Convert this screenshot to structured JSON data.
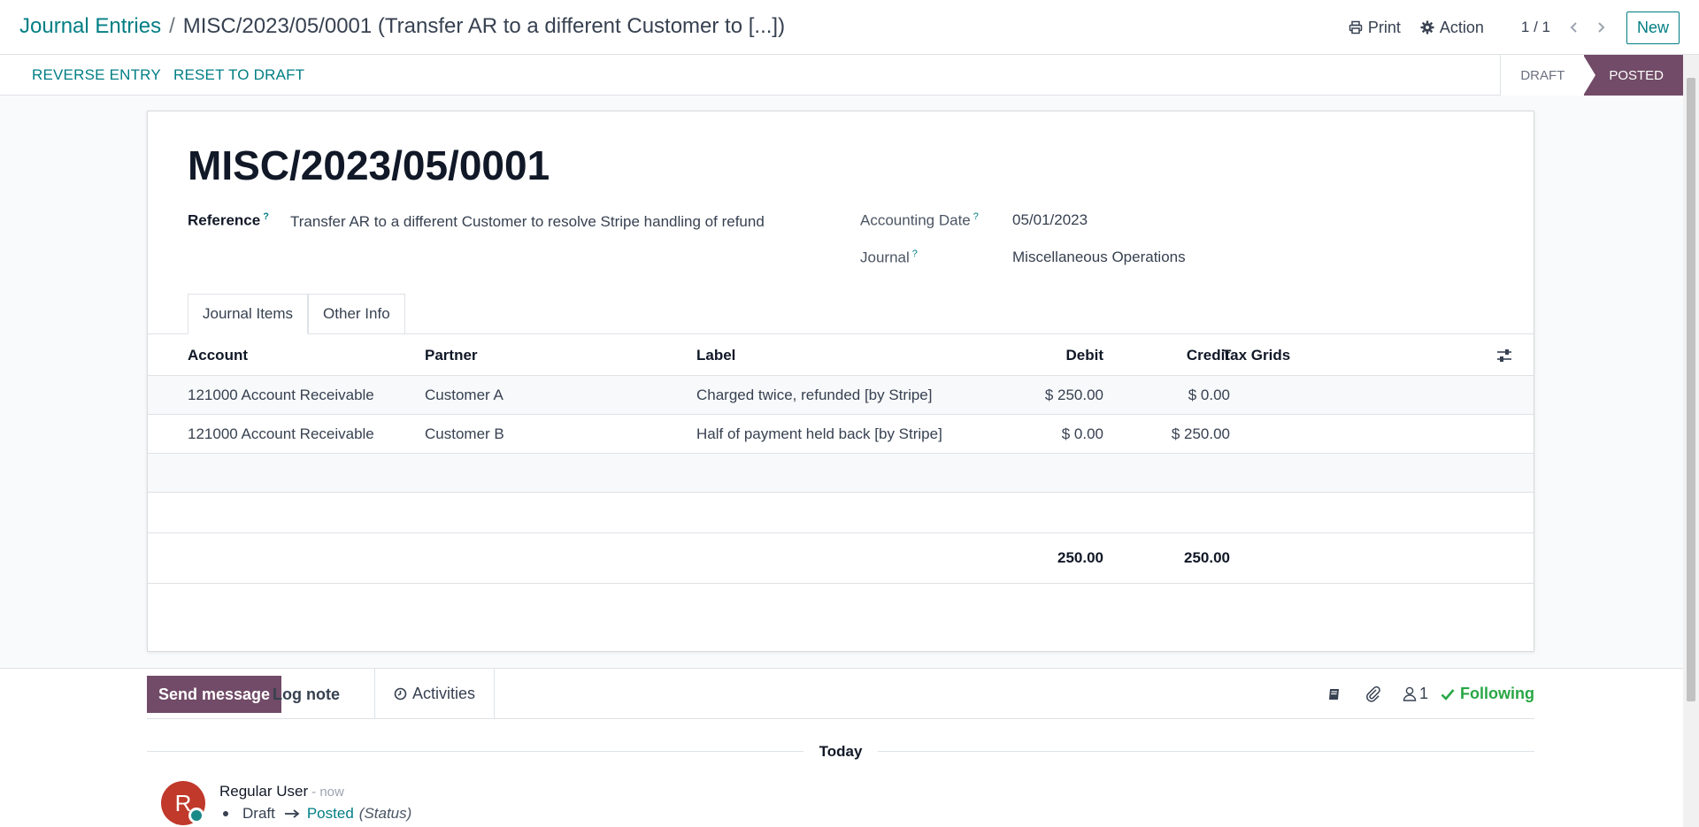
{
  "breadcrumb": {
    "parent": "Journal Entries",
    "separator": "/",
    "current": "MISC/2023/05/0001 (Transfer AR to a different Customer to [...])"
  },
  "top_actions": {
    "print": "Print",
    "action": "Action",
    "pager": "1 / 1",
    "new": "New"
  },
  "statusbar": {
    "reverse": "Reverse Entry",
    "reset": "Reset to Draft",
    "stages": [
      "DRAFT",
      "POSTED"
    ],
    "active_stage": "POSTED"
  },
  "form": {
    "title": "MISC/2023/05/0001",
    "reference_label": "Reference",
    "reference_value": "Transfer AR to a different Customer to resolve Stripe handling of refund",
    "accounting_date_label": "Accounting Date",
    "accounting_date_value": "05/01/2023",
    "journal_label": "Journal",
    "journal_value": "Miscellaneous Operations",
    "help_mark": "?"
  },
  "tabs": [
    {
      "label": "Journal Items",
      "active": true
    },
    {
      "label": "Other Info",
      "active": false
    }
  ],
  "table": {
    "columns": [
      "Account",
      "Partner",
      "Label",
      "Debit",
      "Credit",
      "Tax Grids"
    ],
    "rows": [
      {
        "account": "121000 Account Receivable",
        "partner": "Customer A",
        "label": "Charged twice, refunded [by Stripe]",
        "debit": "$ 250.00",
        "credit": "$ 0.00"
      },
      {
        "account": "121000 Account Receivable",
        "partner": "Customer B",
        "label": "Half of payment held back [by Stripe]",
        "debit": "$ 0.00",
        "credit": "$ 250.00"
      }
    ],
    "total_debit": "250.00",
    "total_credit": "250.00"
  },
  "chatter": {
    "send_message": "Send message",
    "log_note": "Log note",
    "activities": "Activities",
    "followers_count": "1",
    "following": "Following",
    "today": "Today",
    "message": {
      "author": "Regular User",
      "avatar_initial": "R",
      "time": "- now",
      "old_value": "Draft",
      "new_value": "Posted",
      "field": "(Status)"
    }
  },
  "colors": {
    "accent": "#017e84",
    "brand": "#714b67",
    "following": "#28a745",
    "avatar": "#c0392b"
  }
}
